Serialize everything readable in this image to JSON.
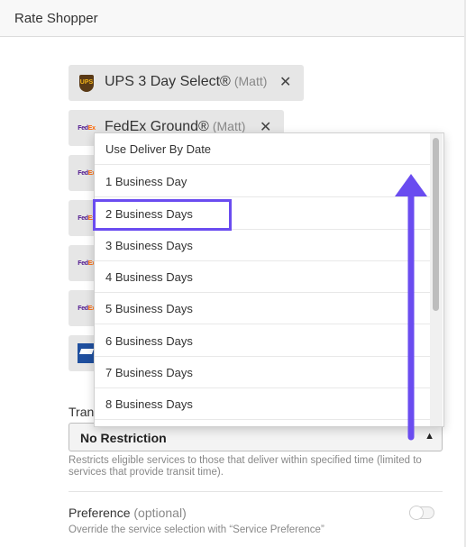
{
  "header": {
    "title": "Rate Shopper"
  },
  "chips": [
    {
      "carrier": "ups",
      "name": "UPS 3 Day Select®",
      "owner": "(Matt)"
    },
    {
      "carrier": "fedex",
      "name": "FedEx Ground®",
      "owner": "(Matt)"
    }
  ],
  "logo_text": {
    "ups": "UPS",
    "fedex_fd": "Fed",
    "fedex_ex": "Ex"
  },
  "close_glyph": "✕",
  "dropdown": {
    "options": [
      "Use Deliver By Date",
      "1 Business Day",
      "2 Business Days",
      "3 Business Days",
      "4 Business Days",
      "5 Business Days",
      "6 Business Days",
      "7 Business Days",
      "8 Business Days"
    ],
    "highlighted": "2 Business Days"
  },
  "transit": {
    "label": "Trans",
    "value": "No Restriction",
    "caret": "▲",
    "help": "Restricts eligible services to those that deliver within specified time (limited to services that provide transit time)."
  },
  "preference": {
    "title": "Preference",
    "optional": "(optional)",
    "description": "Override the service selection with “Service Preference”",
    "enabled": false
  },
  "colors": {
    "annotation": "#6a4cf0",
    "chip_bg": "#e6e6e6",
    "select_bg": "#f3f3f3"
  }
}
